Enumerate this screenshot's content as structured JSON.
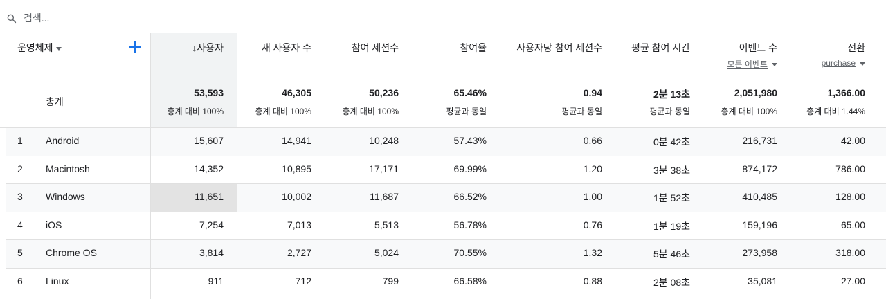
{
  "search": {
    "placeholder": "검색..."
  },
  "dimension": {
    "label": "운영체제"
  },
  "columns": [
    {
      "key": "users",
      "label": "↓사용자"
    },
    {
      "key": "new_users",
      "label": "새 사용자 수"
    },
    {
      "key": "engaged_sessions",
      "label": "참여 세션수"
    },
    {
      "key": "engagement_rate",
      "label": "참여율"
    },
    {
      "key": "engaged_per_user",
      "label": "사용자당 참여 세션수"
    },
    {
      "key": "avg_engagement",
      "label": "평균 참여 시간"
    },
    {
      "key": "event_count",
      "label": "이벤트 수",
      "sub": "모든 이벤트"
    },
    {
      "key": "conversions",
      "label": "전환",
      "sub": "purchase"
    }
  ],
  "totals": {
    "label": "총계",
    "values": [
      "53,593",
      "46,305",
      "50,236",
      "65.46%",
      "0.94",
      "2분 13초",
      "2,051,980",
      "1,366.00"
    ],
    "subs": [
      "총계 대비 100%",
      "총계 대비 100%",
      "총계 대비 100%",
      "평균과 동일",
      "평균과 동일",
      "평균과 동일",
      "총계 대비 100%",
      "총계 대비 1.44%"
    ]
  },
  "rows": [
    {
      "rank": "1",
      "name": "Android",
      "values": [
        "15,607",
        "14,941",
        "10,248",
        "57.43%",
        "0.66",
        "0분 42초",
        "216,731",
        "42.00"
      ]
    },
    {
      "rank": "2",
      "name": "Macintosh",
      "values": [
        "14,352",
        "10,895",
        "17,171",
        "69.99%",
        "1.20",
        "3분 38초",
        "874,172",
        "786.00"
      ]
    },
    {
      "rank": "3",
      "name": "Windows",
      "values": [
        "11,651",
        "10,002",
        "11,687",
        "66.52%",
        "1.00",
        "1분 52초",
        "410,485",
        "128.00"
      ]
    },
    {
      "rank": "4",
      "name": "iOS",
      "values": [
        "7,254",
        "7,013",
        "5,513",
        "56.78%",
        "0.76",
        "1분 19초",
        "159,196",
        "65.00"
      ]
    },
    {
      "rank": "5",
      "name": "Chrome OS",
      "values": [
        "3,814",
        "2,727",
        "5,024",
        "70.55%",
        "1.32",
        "5분 46초",
        "273,958",
        "318.00"
      ]
    },
    {
      "rank": "6",
      "name": "Linux",
      "values": [
        "911",
        "712",
        "799",
        "66.58%",
        "0.88",
        "2분 08초",
        "35,081",
        "27.00"
      ]
    }
  ],
  "colors": {
    "accent": "#1a73e8",
    "sort_column_bg": "#f1f3f4",
    "row_stripe": "#f8f9fa",
    "hover_bg": "#e3e3e3"
  },
  "icons": {
    "search": "search-icon",
    "add": "add-plus-icon",
    "dropdown": "caret-down-icon"
  }
}
